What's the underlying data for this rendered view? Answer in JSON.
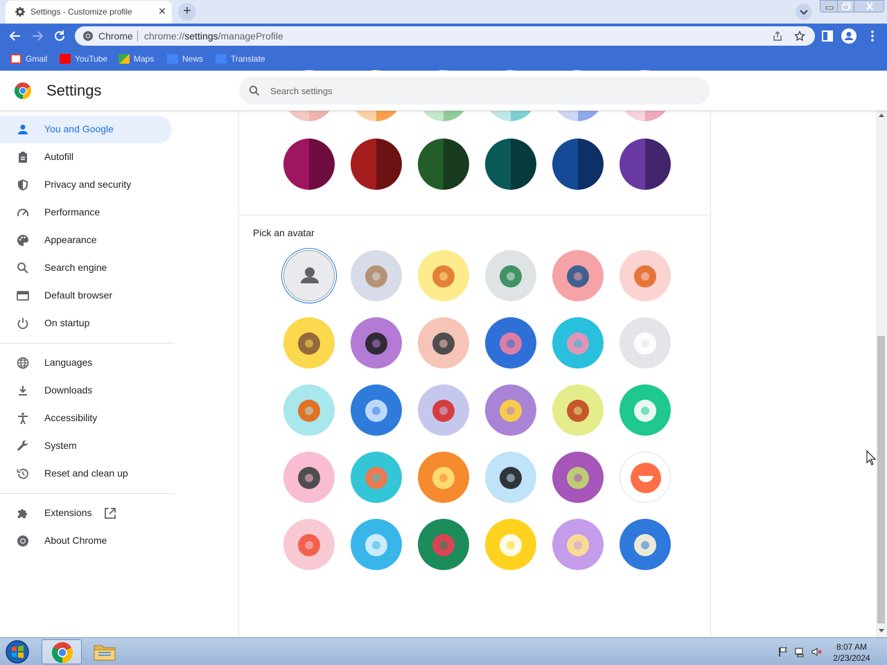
{
  "tab": {
    "title": "Settings - Customize profile",
    "close_glyph": "✕",
    "new_tab_glyph": "+"
  },
  "omnibox": {
    "chip": "Chrome",
    "url_scheme": "chrome://",
    "url_host": "settings",
    "url_path": "/manageProfile"
  },
  "bookmarks": [
    {
      "label": "Gmail",
      "icon": "gmail-icon",
      "color": "#ea4335"
    },
    {
      "label": "YouTube",
      "icon": "youtube-icon",
      "color": "#ff0000"
    },
    {
      "label": "Maps",
      "icon": "maps-icon",
      "color": "#34a853"
    },
    {
      "label": "News",
      "icon": "news-icon",
      "color": "#4285f4"
    },
    {
      "label": "Translate",
      "icon": "translate-icon",
      "color": "#4285f4"
    }
  ],
  "header": {
    "title": "Settings",
    "search_placeholder": "Search settings"
  },
  "sidebar": {
    "items": [
      {
        "label": "You and Google",
        "icon": "person-icon",
        "active": true
      },
      {
        "label": "Autofill",
        "icon": "clipboard-icon"
      },
      {
        "label": "Privacy and security",
        "icon": "shield-icon"
      },
      {
        "label": "Performance",
        "icon": "gauge-icon"
      },
      {
        "label": "Appearance",
        "icon": "palette-icon"
      },
      {
        "label": "Search engine",
        "icon": "search-icon"
      },
      {
        "label": "Default browser",
        "icon": "browser-window-icon"
      },
      {
        "label": "On startup",
        "icon": "power-icon"
      },
      {
        "label": "Languages",
        "icon": "globe-icon"
      },
      {
        "label": "Downloads",
        "icon": "download-icon"
      },
      {
        "label": "Accessibility",
        "icon": "accessibility-icon"
      },
      {
        "label": "System",
        "icon": "wrench-icon"
      },
      {
        "label": "Reset and clean up",
        "icon": "history-icon"
      },
      {
        "label": "Extensions",
        "icon": "puzzle-icon"
      },
      {
        "label": "About Chrome",
        "icon": "chrome-icon"
      }
    ]
  },
  "main": {
    "color_swatches": [
      {
        "name": "berry",
        "left": "#9e1660",
        "right": "#6e0c40"
      },
      {
        "name": "red",
        "left": "#a51d1d",
        "right": "#6d1212"
      },
      {
        "name": "green",
        "left": "#235e2a",
        "right": "#173b1c"
      },
      {
        "name": "teal",
        "left": "#0b5a5a",
        "right": "#063b3b"
      },
      {
        "name": "blue",
        "left": "#154a96",
        "right": "#0d3166"
      },
      {
        "name": "purple",
        "left": "#6a3aa3",
        "right": "#43256d"
      }
    ],
    "avatar_heading": "Pick an avatar",
    "avatars": [
      {
        "name": "generic-person",
        "bg": "#e8eaed",
        "fg": "#5f6368",
        "selected": true
      },
      {
        "name": "cat",
        "bg": "#d8dce8",
        "fg": "#b08a68",
        "selected": false
      },
      {
        "name": "corgi",
        "bg": "#fdeb8c",
        "fg": "#e0762c",
        "selected": false
      },
      {
        "name": "dragon",
        "bg": "#e0e3e6",
        "fg": "#2f8a57",
        "selected": false
      },
      {
        "name": "elephant",
        "bg": "#f6a3a8",
        "fg": "#2c5a8c",
        "selected": false
      },
      {
        "name": "fox",
        "bg": "#fbd3d0",
        "fg": "#e36a2a",
        "selected": false
      },
      {
        "name": "monkey",
        "bg": "#fcd84e",
        "fg": "#8a5d38",
        "selected": false
      },
      {
        "name": "panda",
        "bg": "#b37ad6",
        "fg": "#202124",
        "selected": false
      },
      {
        "name": "penguin",
        "bg": "#f7c4b8",
        "fg": "#3c4043",
        "selected": false
      },
      {
        "name": "butterfly",
        "bg": "#2f6fd8",
        "fg": "#f07fa0",
        "selected": false
      },
      {
        "name": "rabbit",
        "bg": "#28c0dc",
        "fg": "#f48fb1",
        "selected": false
      },
      {
        "name": "unicorn",
        "bg": "#e3e5e8",
        "fg": "#ffffff",
        "selected": false
      },
      {
        "name": "basketball",
        "bg": "#a8e7ec",
        "fg": "#e8630f",
        "selected": false
      },
      {
        "name": "bike",
        "bg": "#2f7bdc",
        "fg": "#cfe3ff",
        "selected": false
      },
      {
        "name": "bird",
        "bg": "#c6c7ec",
        "fg": "#d62d2d",
        "selected": false
      },
      {
        "name": "cheese",
        "bg": "#a984d6",
        "fg": "#ffd43a",
        "selected": false
      },
      {
        "name": "football",
        "bg": "#e4ec8c",
        "fg": "#c0481f",
        "selected": false
      },
      {
        "name": "ramen",
        "bg": "#1fc88c",
        "fg": "#ffffff",
        "selected": false
      },
      {
        "name": "sunglasses",
        "bg": "#f8bdd3",
        "fg": "#3c4043",
        "selected": false
      },
      {
        "name": "sushi",
        "bg": "#33c6d6",
        "fg": "#ff7043",
        "selected": false
      },
      {
        "name": "tamagotchi",
        "bg": "#f58a2e",
        "fg": "#ffe27a",
        "selected": false
      },
      {
        "name": "vinyl",
        "bg": "#bfe3f8",
        "fg": "#202124",
        "selected": false
      },
      {
        "name": "avocado",
        "bg": "#a655b8",
        "fg": "#c0d86a",
        "selected": false
      },
      {
        "name": "smile",
        "bg": "#ffffff",
        "fg": "#ff6f47",
        "selected": false
      },
      {
        "name": "ice-cream",
        "bg": "#f8c9d3",
        "fg": "#f2553f",
        "selected": false
      },
      {
        "name": "ice-cube",
        "bg": "#38b6ea",
        "fg": "#d9f2ff",
        "selected": false
      },
      {
        "name": "watermelon",
        "bg": "#1c8c5a",
        "fg": "#ee3d52",
        "selected": false
      },
      {
        "name": "onigiri",
        "bg": "#ffd21f",
        "fg": "#ffffff",
        "selected": false
      },
      {
        "name": "pizza",
        "bg": "#c49cea",
        "fg": "#ffe08a",
        "selected": false
      },
      {
        "name": "sandwich",
        "bg": "#2f78dc",
        "fg": "#fff6d6",
        "selected": false
      }
    ]
  },
  "taskbar": {
    "time": "8:07 AM",
    "date": "2/23/2024"
  },
  "colors": {
    "accent": "#1a73e8",
    "toolbar": "#3b6fd6",
    "tabstrip": "#dfe7f7"
  }
}
